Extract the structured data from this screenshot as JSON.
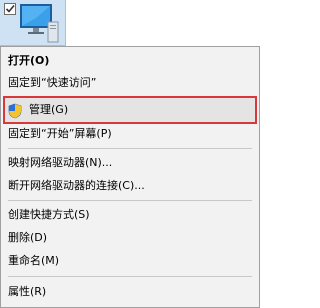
{
  "desktop": {
    "icon": "this-pc-icon",
    "checkbox": "checked"
  },
  "menu": {
    "items": [
      {
        "label": "打开(O)"
      },
      {
        "label": "固定到“快速访问”"
      },
      {
        "label": "管理(G)",
        "icon": "uac-shield-icon"
      },
      {
        "label": "固定到“开始”屏幕(P)"
      },
      {
        "label": "映射网络驱动器(N)..."
      },
      {
        "label": "断开网络驱动器的连接(C)..."
      },
      {
        "label": "创建快捷方式(S)"
      },
      {
        "label": "删除(D)"
      },
      {
        "label": "重命名(M)"
      },
      {
        "label": "属性(R)"
      }
    ]
  },
  "colors": {
    "highlight_border": "#d9383a",
    "menu_background": "#f2f2f2",
    "icon_selection": "#cfe2f4"
  }
}
